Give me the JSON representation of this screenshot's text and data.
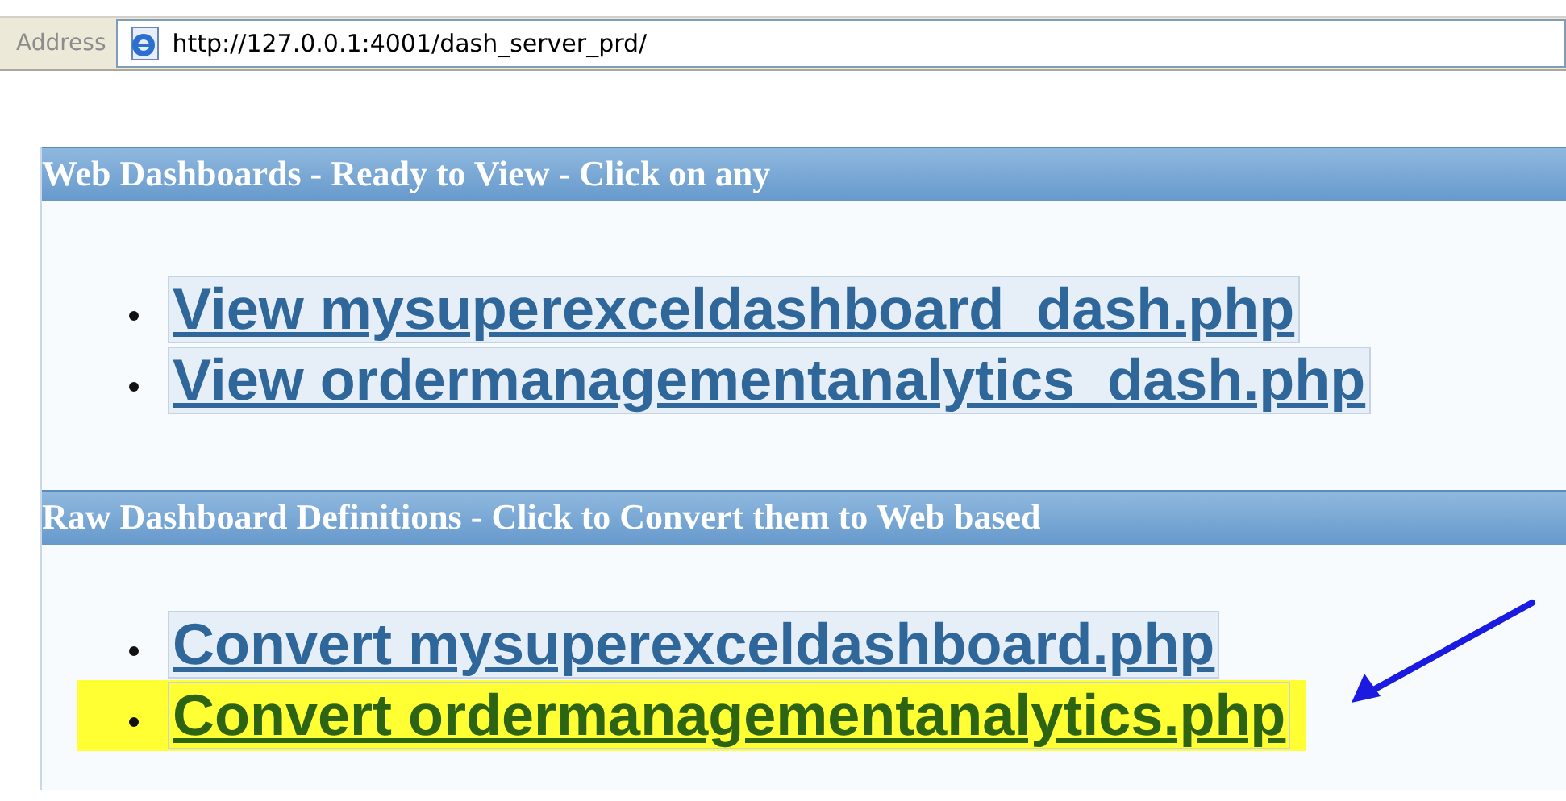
{
  "address_bar": {
    "label": "Address",
    "url": "http://127.0.0.1:4001/dash_server_prd/"
  },
  "sections": [
    {
      "title": "Web Dashboards - Ready to View - Click on any",
      "links": [
        {
          "text": "View mysuperexceldashboard_dash.php",
          "highlighted": false
        },
        {
          "text": "View ordermanagementanalytics_dash.php",
          "highlighted": false
        }
      ]
    },
    {
      "title": "Raw Dashboard Definitions - Click to Convert them to Web based",
      "links": [
        {
          "text": "Convert mysuperexceldashboard.php",
          "highlighted": false
        },
        {
          "text": "Convert ordermanagementanalytics.php",
          "highlighted": true
        }
      ]
    }
  ]
}
